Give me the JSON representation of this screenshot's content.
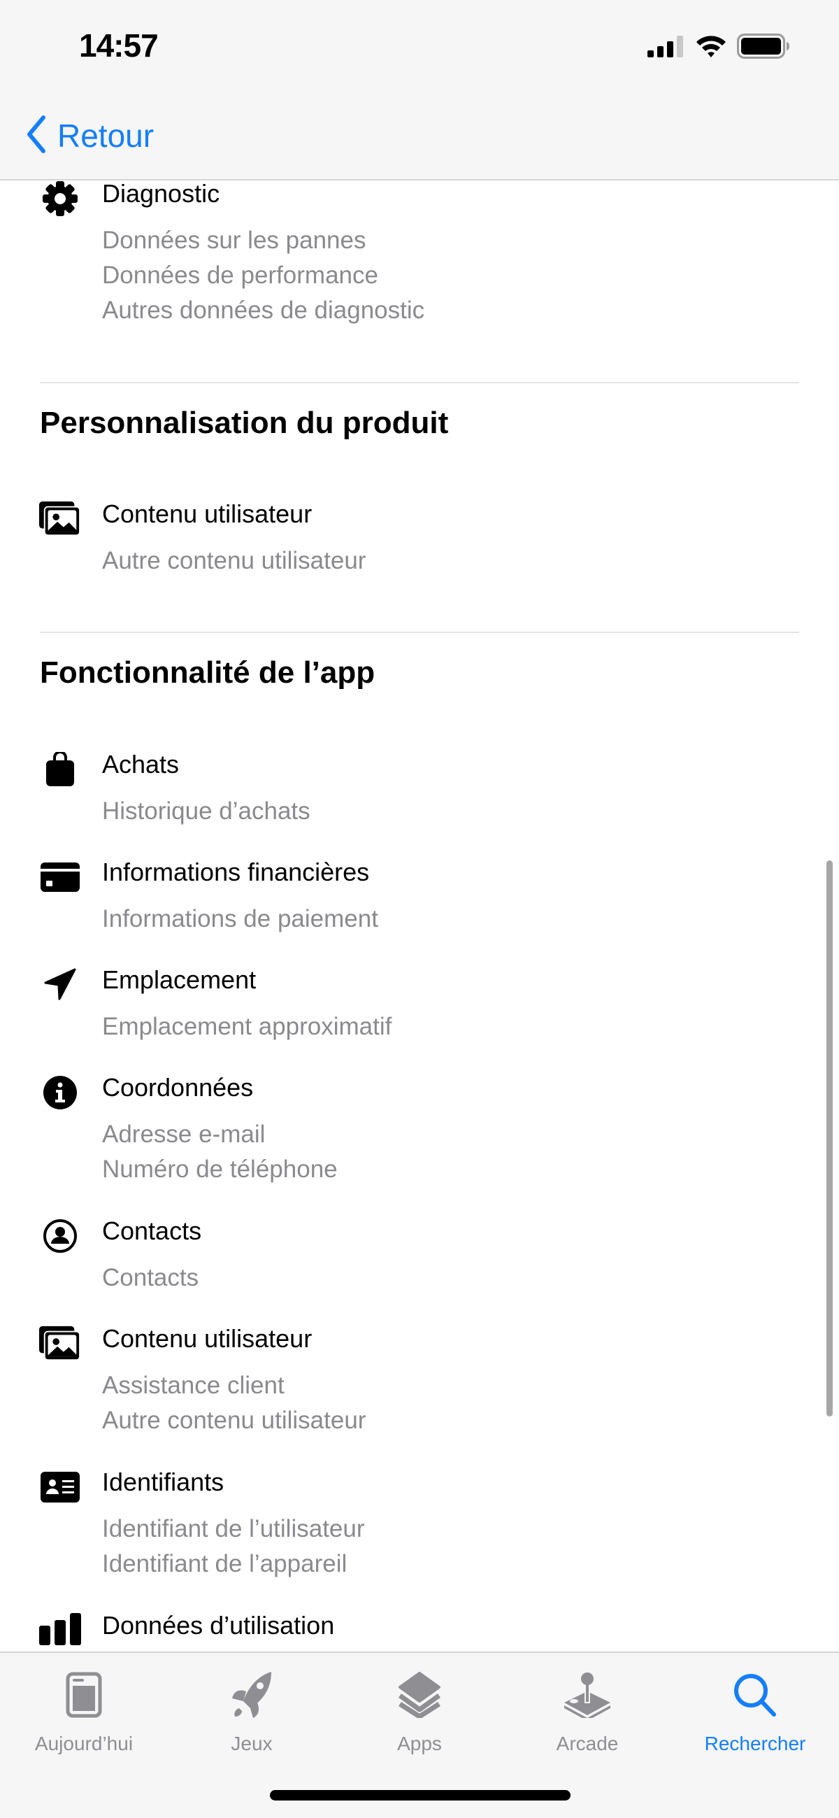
{
  "status_bar": {
    "time": "14:57",
    "icons": [
      "cellular-signal-icon",
      "wifi-icon",
      "battery-icon"
    ]
  },
  "nav": {
    "back_label": "Retour",
    "back_icon": "chevron-left-icon"
  },
  "sections": [
    {
      "title": "",
      "items": [
        {
          "icon": "gear-icon",
          "title": "Diagnostic",
          "details": [
            "Données sur les pannes",
            "Données de performance",
            "Autres données de diagnostic"
          ]
        }
      ]
    },
    {
      "title": "Personnalisation du produit",
      "items": [
        {
          "icon": "photos-icon",
          "title": "Contenu utilisateur",
          "details": [
            "Autre contenu utilisateur"
          ]
        }
      ]
    },
    {
      "title": "Fonctionnalité de l’app",
      "items": [
        {
          "icon": "bag-icon",
          "title": "Achats",
          "details": [
            "Historique d’achats"
          ]
        },
        {
          "icon": "credit-card-icon",
          "title": "Informations financières",
          "details": [
            "Informations de paiement"
          ]
        },
        {
          "icon": "location-arrow-icon",
          "title": "Emplacement",
          "details": [
            "Emplacement approximatif"
          ]
        },
        {
          "icon": "info-circle-icon",
          "title": "Coordonnées",
          "details": [
            "Adresse e-mail",
            "Numéro de téléphone"
          ]
        },
        {
          "icon": "person-circle-icon",
          "title": "Contacts",
          "details": [
            "Contacts"
          ]
        },
        {
          "icon": "photos-icon",
          "title": "Contenu utilisateur",
          "details": [
            "Assistance client",
            "Autre contenu utilisateur"
          ]
        },
        {
          "icon": "id-card-icon",
          "title": "Identifiants",
          "details": [
            "Identifiant de l’utilisateur",
            "Identifiant de l’appareil"
          ]
        },
        {
          "icon": "bar-chart-icon",
          "title": "Données d’utilisation",
          "details": []
        }
      ]
    }
  ],
  "tab_bar": {
    "tabs": [
      {
        "label": "Aujourd’hui",
        "icon": "today-icon",
        "active": false
      },
      {
        "label": "Jeux",
        "icon": "rocket-icon",
        "active": false
      },
      {
        "label": "Apps",
        "icon": "apps-stack-icon",
        "active": false
      },
      {
        "label": "Arcade",
        "icon": "joystick-icon",
        "active": false
      },
      {
        "label": "Rechercher",
        "icon": "search-icon",
        "active": true
      }
    ]
  },
  "colors": {
    "accent": "#147efb",
    "secondary_text": "#8a8a8e",
    "tab_inactive": "#8e8e93",
    "bar_background": "#f6f6f6"
  }
}
